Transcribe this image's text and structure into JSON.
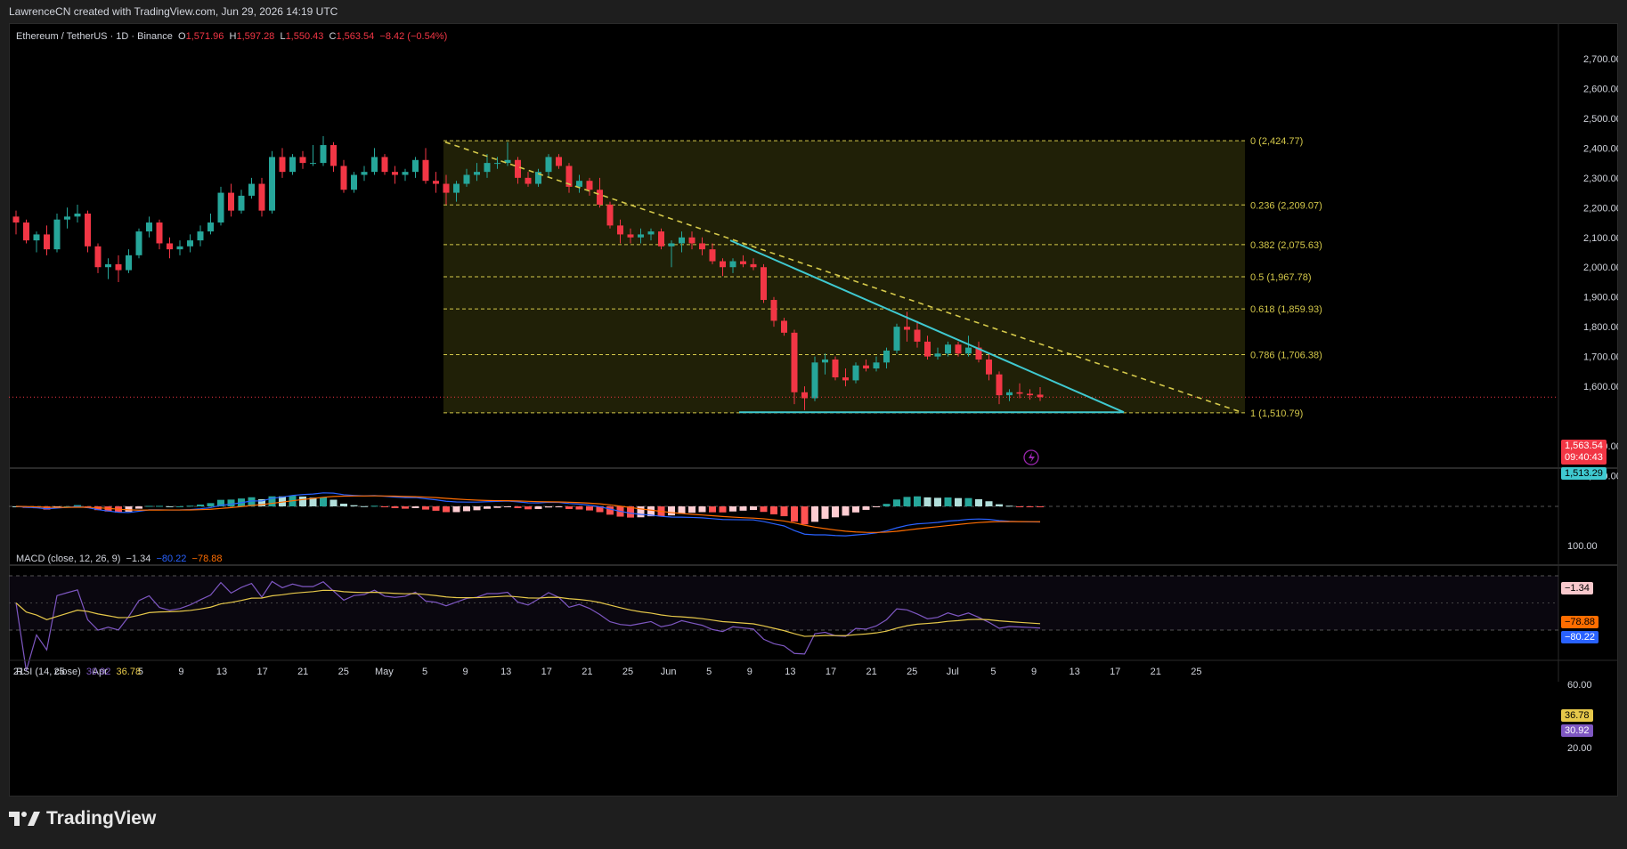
{
  "header": {
    "attribution": "LawrenceCN created with TradingView.com, Jun 29, 2026 14:19 UTC"
  },
  "symbol": {
    "title": "Ethereum / TetherUS · 1D · Binance",
    "open_label": "O",
    "open": "1,571.96",
    "high_label": "H",
    "high": "1,597.28",
    "low_label": "L",
    "low": "1,550.43",
    "close_label": "C",
    "close": "1,563.54",
    "change": "−8.42 (−0.54%)"
  },
  "price_tags": {
    "last": "1,563.54",
    "countdown": "09:40:43",
    "support": "1,513.29"
  },
  "macd_panel": {
    "label": "MACD (close, 12, 26, 9)",
    "hist": "−1.34",
    "macd": "−80.22",
    "signal": "−78.88",
    "axis_top": "100.00",
    "tag_hist": "−1.34",
    "tag_signal": "−78.88",
    "tag_macd": "−80.22"
  },
  "rsi_panel": {
    "label": "RSI (14, close)",
    "rsi": "30.92",
    "ma": "36.78",
    "axis": [
      "60.00",
      "20.00"
    ],
    "tag_ma": "36.78",
    "tag_rsi": "30.92"
  },
  "colors": {
    "up": "#26a69a",
    "down": "#f23645",
    "trend": "#3fc9d0",
    "fib": "#d4c84a",
    "macd": "#2962ff",
    "signal": "#ff6d00",
    "rsi": "#7e57c2"
  },
  "footer": {
    "brand": "TradingView",
    "brand_icon": "tradingview-logo-icon"
  },
  "icons": {
    "alert": "lightning-icon"
  },
  "chart_data": {
    "type": "candlestick",
    "title": "Ethereum / TetherUS · 1D · Binance",
    "y_axis": {
      "ticks": [
        "2,700.00",
        "2,600.00",
        "2,500.00",
        "2,400.00",
        "2,300.00",
        "2,200.00",
        "2,100.00",
        "2,000.00",
        "1,900.00",
        "1,800.00",
        "1,700.00",
        "1,600.00",
        "1,400.00",
        "1,300.00"
      ],
      "range": [
        1300,
        2750
      ]
    },
    "x_axis": {
      "ticks": [
        "21",
        "25",
        "Apr",
        "5",
        "9",
        "13",
        "17",
        "21",
        "25",
        "May",
        "5",
        "9",
        "13",
        "17",
        "21",
        "25",
        "Jun",
        "5",
        "9",
        "13",
        "17",
        "21",
        "25",
        "Jul",
        "5",
        "9",
        "13",
        "17",
        "21",
        "25"
      ]
    },
    "fibonacci": [
      {
        "label": "0 (2,424.77)",
        "level": 2424.77
      },
      {
        "label": "0.236 (2,209.07)",
        "level": 2209.07
      },
      {
        "label": "0.382 (2,075.63)",
        "level": 2075.63
      },
      {
        "label": "0.5 (1,967.78)",
        "level": 1967.78
      },
      {
        "label": "0.618 (1,859.93)",
        "level": 1859.93
      },
      {
        "label": "0.786 (1,706.38)",
        "level": 1706.38
      },
      {
        "label": "1 (1,510.79)",
        "level": 1510.79
      }
    ],
    "candles": [
      {
        "o": 2170,
        "h": 2190,
        "l": 2110,
        "c": 2150
      },
      {
        "o": 2150,
        "h": 2160,
        "l": 2080,
        "c": 2090
      },
      {
        "o": 2090,
        "h": 2120,
        "l": 2050,
        "c": 2110
      },
      {
        "o": 2110,
        "h": 2140,
        "l": 2040,
        "c": 2060
      },
      {
        "o": 2060,
        "h": 2180,
        "l": 2050,
        "c": 2160
      },
      {
        "o": 2160,
        "h": 2200,
        "l": 2130,
        "c": 2170
      },
      {
        "o": 2170,
        "h": 2210,
        "l": 2150,
        "c": 2180
      },
      {
        "o": 2180,
        "h": 2190,
        "l": 2050,
        "c": 2070
      },
      {
        "o": 2070,
        "h": 2080,
        "l": 1980,
        "c": 2000
      },
      {
        "o": 2000,
        "h": 2030,
        "l": 1960,
        "c": 2010
      },
      {
        "o": 2010,
        "h": 2040,
        "l": 1950,
        "c": 1990
      },
      {
        "o": 1990,
        "h": 2060,
        "l": 1980,
        "c": 2040
      },
      {
        "o": 2040,
        "h": 2130,
        "l": 2030,
        "c": 2120
      },
      {
        "o": 2120,
        "h": 2170,
        "l": 2100,
        "c": 2150
      },
      {
        "o": 2150,
        "h": 2160,
        "l": 2060,
        "c": 2080
      },
      {
        "o": 2080,
        "h": 2100,
        "l": 2030,
        "c": 2060
      },
      {
        "o": 2060,
        "h": 2090,
        "l": 2040,
        "c": 2070
      },
      {
        "o": 2070,
        "h": 2110,
        "l": 2050,
        "c": 2090
      },
      {
        "o": 2090,
        "h": 2140,
        "l": 2070,
        "c": 2120
      },
      {
        "o": 2120,
        "h": 2180,
        "l": 2110,
        "c": 2150
      },
      {
        "o": 2150,
        "h": 2270,
        "l": 2140,
        "c": 2250
      },
      {
        "o": 2250,
        "h": 2280,
        "l": 2170,
        "c": 2190
      },
      {
        "o": 2190,
        "h": 2260,
        "l": 2180,
        "c": 2240
      },
      {
        "o": 2240,
        "h": 2300,
        "l": 2230,
        "c": 2280
      },
      {
        "o": 2280,
        "h": 2300,
        "l": 2170,
        "c": 2190
      },
      {
        "o": 2190,
        "h": 2390,
        "l": 2180,
        "c": 2370
      },
      {
        "o": 2370,
        "h": 2400,
        "l": 2300,
        "c": 2320
      },
      {
        "o": 2320,
        "h": 2380,
        "l": 2310,
        "c": 2370
      },
      {
        "o": 2370,
        "h": 2390,
        "l": 2330,
        "c": 2350
      },
      {
        "o": 2350,
        "h": 2410,
        "l": 2340,
        "c": 2350
      },
      {
        "o": 2350,
        "h": 2440,
        "l": 2340,
        "c": 2410
      },
      {
        "o": 2410,
        "h": 2420,
        "l": 2320,
        "c": 2340
      },
      {
        "o": 2340,
        "h": 2360,
        "l": 2250,
        "c": 2260
      },
      {
        "o": 2260,
        "h": 2320,
        "l": 2250,
        "c": 2310
      },
      {
        "o": 2310,
        "h": 2340,
        "l": 2290,
        "c": 2320
      },
      {
        "o": 2320,
        "h": 2400,
        "l": 2310,
        "c": 2370
      },
      {
        "o": 2370,
        "h": 2380,
        "l": 2310,
        "c": 2320
      },
      {
        "o": 2320,
        "h": 2340,
        "l": 2280,
        "c": 2310
      },
      {
        "o": 2310,
        "h": 2330,
        "l": 2290,
        "c": 2320
      },
      {
        "o": 2320,
        "h": 2370,
        "l": 2300,
        "c": 2360
      },
      {
        "o": 2360,
        "h": 2400,
        "l": 2280,
        "c": 2290
      },
      {
        "o": 2290,
        "h": 2320,
        "l": 2250,
        "c": 2280
      },
      {
        "o": 2280,
        "h": 2310,
        "l": 2210,
        "c": 2250
      },
      {
        "o": 2250,
        "h": 2290,
        "l": 2220,
        "c": 2280
      },
      {
        "o": 2280,
        "h": 2330,
        "l": 2270,
        "c": 2310
      },
      {
        "o": 2310,
        "h": 2350,
        "l": 2290,
        "c": 2320
      },
      {
        "o": 2320,
        "h": 2380,
        "l": 2300,
        "c": 2350
      },
      {
        "o": 2350,
        "h": 2370,
        "l": 2330,
        "c": 2350
      },
      {
        "o": 2350,
        "h": 2420,
        "l": 2340,
        "c": 2360
      },
      {
        "o": 2360,
        "h": 2370,
        "l": 2280,
        "c": 2300
      },
      {
        "o": 2300,
        "h": 2320,
        "l": 2270,
        "c": 2280
      },
      {
        "o": 2280,
        "h": 2330,
        "l": 2270,
        "c": 2320
      },
      {
        "o": 2320,
        "h": 2380,
        "l": 2300,
        "c": 2370
      },
      {
        "o": 2370,
        "h": 2380,
        "l": 2330,
        "c": 2340
      },
      {
        "o": 2340,
        "h": 2350,
        "l": 2250,
        "c": 2270
      },
      {
        "o": 2270,
        "h": 2310,
        "l": 2250,
        "c": 2290
      },
      {
        "o": 2290,
        "h": 2300,
        "l": 2240,
        "c": 2260
      },
      {
        "o": 2260,
        "h": 2300,
        "l": 2200,
        "c": 2210
      },
      {
        "o": 2210,
        "h": 2220,
        "l": 2130,
        "c": 2140
      },
      {
        "o": 2140,
        "h": 2160,
        "l": 2080,
        "c": 2110
      },
      {
        "o": 2110,
        "h": 2130,
        "l": 2080,
        "c": 2100
      },
      {
        "o": 2100,
        "h": 2130,
        "l": 2080,
        "c": 2110
      },
      {
        "o": 2110,
        "h": 2130,
        "l": 2090,
        "c": 2120
      },
      {
        "o": 2120,
        "h": 2130,
        "l": 2060,
        "c": 2070
      },
      {
        "o": 2070,
        "h": 2090,
        "l": 2000,
        "c": 2080
      },
      {
        "o": 2080,
        "h": 2120,
        "l": 2050,
        "c": 2100
      },
      {
        "o": 2100,
        "h": 2120,
        "l": 2060,
        "c": 2080
      },
      {
        "o": 2080,
        "h": 2100,
        "l": 2040,
        "c": 2060
      },
      {
        "o": 2060,
        "h": 2080,
        "l": 2010,
        "c": 2020
      },
      {
        "o": 2020,
        "h": 2030,
        "l": 1970,
        "c": 2000
      },
      {
        "o": 2000,
        "h": 2030,
        "l": 1980,
        "c": 2020
      },
      {
        "o": 2020,
        "h": 2040,
        "l": 2000,
        "c": 2010
      },
      {
        "o": 2010,
        "h": 2030,
        "l": 1990,
        "c": 2000
      },
      {
        "o": 2000,
        "h": 2010,
        "l": 1880,
        "c": 1890
      },
      {
        "o": 1890,
        "h": 1900,
        "l": 1800,
        "c": 1820
      },
      {
        "o": 1820,
        "h": 1830,
        "l": 1770,
        "c": 1780
      },
      {
        "o": 1780,
        "h": 1790,
        "l": 1540,
        "c": 1580
      },
      {
        "o": 1580,
        "h": 1600,
        "l": 1520,
        "c": 1560
      },
      {
        "o": 1560,
        "h": 1700,
        "l": 1550,
        "c": 1680
      },
      {
        "o": 1680,
        "h": 1710,
        "l": 1640,
        "c": 1690
      },
      {
        "o": 1690,
        "h": 1700,
        "l": 1620,
        "c": 1630
      },
      {
        "o": 1630,
        "h": 1660,
        "l": 1600,
        "c": 1620
      },
      {
        "o": 1620,
        "h": 1680,
        "l": 1610,
        "c": 1670
      },
      {
        "o": 1670,
        "h": 1690,
        "l": 1650,
        "c": 1660
      },
      {
        "o": 1660,
        "h": 1700,
        "l": 1650,
        "c": 1680
      },
      {
        "o": 1680,
        "h": 1730,
        "l": 1660,
        "c": 1720
      },
      {
        "o": 1720,
        "h": 1810,
        "l": 1710,
        "c": 1800
      },
      {
        "o": 1800,
        "h": 1850,
        "l": 1750,
        "c": 1790
      },
      {
        "o": 1790,
        "h": 1820,
        "l": 1730,
        "c": 1750
      },
      {
        "o": 1750,
        "h": 1770,
        "l": 1690,
        "c": 1700
      },
      {
        "o": 1700,
        "h": 1730,
        "l": 1690,
        "c": 1710
      },
      {
        "o": 1710,
        "h": 1750,
        "l": 1700,
        "c": 1740
      },
      {
        "o": 1740,
        "h": 1750,
        "l": 1700,
        "c": 1710
      },
      {
        "o": 1710,
        "h": 1770,
        "l": 1700,
        "c": 1730
      },
      {
        "o": 1730,
        "h": 1750,
        "l": 1680,
        "c": 1690
      },
      {
        "o": 1690,
        "h": 1710,
        "l": 1620,
        "c": 1640
      },
      {
        "o": 1640,
        "h": 1650,
        "l": 1540,
        "c": 1570
      },
      {
        "o": 1570,
        "h": 1590,
        "l": 1550,
        "c": 1580
      },
      {
        "o": 1580,
        "h": 1610,
        "l": 1560,
        "c": 1575
      },
      {
        "o": 1575,
        "h": 1590,
        "l": 1555,
        "c": 1570
      },
      {
        "o": 1571.96,
        "h": 1597.28,
        "l": 1550.43,
        "c": 1563.54
      }
    ]
  }
}
